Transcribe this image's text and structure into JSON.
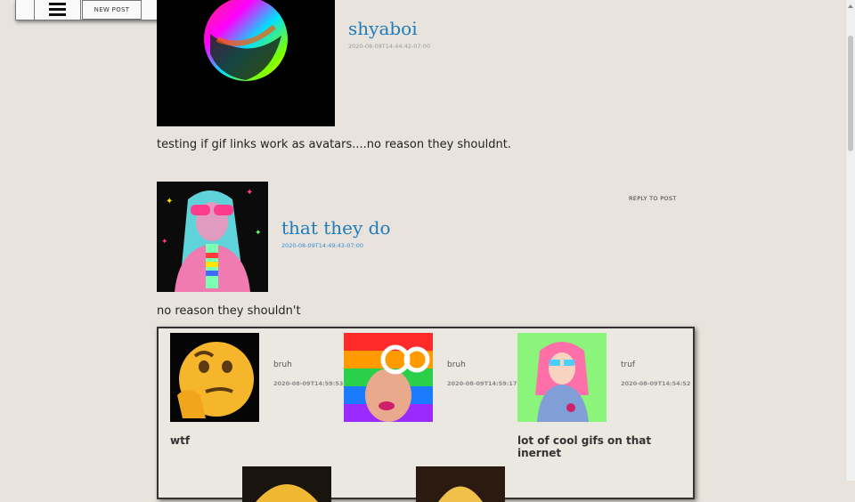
{
  "toolbar": {
    "new_post_label": "NEW POST"
  },
  "posts": [
    {
      "username": "shyaboi",
      "timestamp": "2020-08-09T14:44:42-07:00",
      "body": "testing if gif links work as avatars....no reason they shouldnt."
    },
    {
      "username": "that they do",
      "timestamp": "2020-08-09T14:49:43-07:00",
      "body": "no reason they shouldn't",
      "reply_label": "REPLY TO POST",
      "replies": [
        {
          "name": "bruh",
          "timestamp": "2020-08-09T14:59:53",
          "body": "wtf"
        },
        {
          "name": "bruh",
          "timestamp": "2020-08-09T14:59:17",
          "body": ""
        },
        {
          "name": "truf",
          "timestamp": "2020-08-09T14:54:52",
          "body": "lot of cool gifs on that inernet"
        }
      ]
    }
  ]
}
